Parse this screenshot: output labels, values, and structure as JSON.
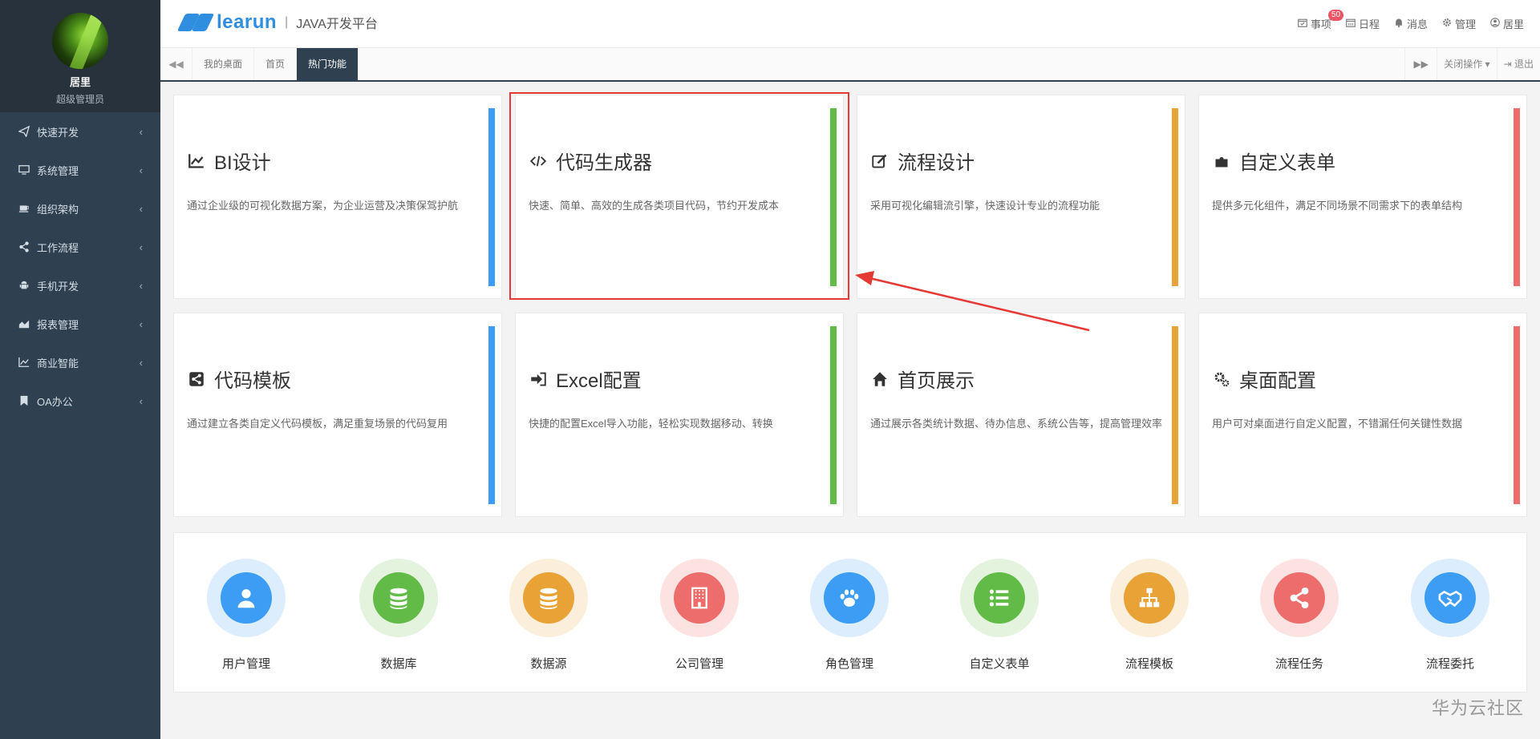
{
  "profile": {
    "name": "居里",
    "role": "超级管理员"
  },
  "sidebar": {
    "items": [
      {
        "label": "快速开发",
        "icon": "send-icon"
      },
      {
        "label": "系统管理",
        "icon": "desktop-icon"
      },
      {
        "label": "组织架构",
        "icon": "coffee-icon"
      },
      {
        "label": "工作流程",
        "icon": "share-icon"
      },
      {
        "label": "手机开发",
        "icon": "android-icon"
      },
      {
        "label": "报表管理",
        "icon": "area-chart-icon"
      },
      {
        "label": "商业智能",
        "icon": "line-chart-icon"
      },
      {
        "label": "OA办公",
        "icon": "bookmark-icon"
      }
    ],
    "arrow": "‹"
  },
  "header": {
    "brand": "learun",
    "separator": "|",
    "subtitle": "JAVA开发平台",
    "menu": [
      {
        "label": "事项",
        "icon": "calendar-check-icon",
        "badge": "50"
      },
      {
        "label": "日程",
        "icon": "calendar-icon"
      },
      {
        "label": "消息",
        "icon": "bell-icon"
      },
      {
        "label": "管理",
        "icon": "gear-icon"
      },
      {
        "label": "居里",
        "icon": "user-circle-icon"
      }
    ]
  },
  "tabs": {
    "items": [
      "我的桌面",
      "首页",
      "热门功能"
    ],
    "active_index": 2,
    "close_ops": "关闭操作",
    "logout": "退出"
  },
  "cards": [
    {
      "title": "BI设计",
      "icon": "line-chart-icon",
      "desc": "通过企业级的可视化数据方案，为企业运营及决策保驾护航",
      "color": "#3d9df4"
    },
    {
      "title": "代码生成器",
      "icon": "code-icon",
      "desc": "快速、简单、高效的生成各类项目代码，节约开发成本",
      "color": "#62bb46"
    },
    {
      "title": "流程设计",
      "icon": "edit-icon",
      "desc": "采用可视化编辑流引擎，快速设计专业的流程功能",
      "color": "#e8a236"
    },
    {
      "title": "自定义表单",
      "icon": "puzzle-icon",
      "desc": "提供多元化组件，满足不同场景不同需求下的表单结构",
      "color": "#ed6d6d"
    },
    {
      "title": "代码模板",
      "icon": "share-square-icon",
      "desc": "通过建立各类自定义代码模板，满足重复场景的代码复用",
      "color": "#3d9df4"
    },
    {
      "title": "Excel配置",
      "icon": "sign-in-icon",
      "desc": "快捷的配置Excel导入功能，轻松实现数据移动、转换",
      "color": "#62bb46"
    },
    {
      "title": "首页展示",
      "icon": "home-icon",
      "desc": "通过展示各类统计数据、待办信息、系统公告等，提高管理效率",
      "color": "#e8a236"
    },
    {
      "title": "桌面配置",
      "icon": "gears-icon",
      "desc": "用户可对桌面进行自定义配置，不错漏任何关键性数据",
      "color": "#ed6d6d"
    }
  ],
  "apps": [
    {
      "label": "用户管理",
      "icon": "user-icon",
      "color": "#3d9df4",
      "ring": "#dcedfd"
    },
    {
      "label": "数据库",
      "icon": "database-icon",
      "color": "#62bb46",
      "ring": "#e3f3de"
    },
    {
      "label": "数据源",
      "icon": "database-icon",
      "color": "#e8a236",
      "ring": "#fbeedb"
    },
    {
      "label": "公司管理",
      "icon": "building-icon",
      "color": "#ed6d6d",
      "ring": "#fde2e2"
    },
    {
      "label": "角色管理",
      "icon": "paw-icon",
      "color": "#3d9df4",
      "ring": "#dcedfd"
    },
    {
      "label": "自定义表单",
      "icon": "list-icon",
      "color": "#62bb46",
      "ring": "#e3f3de"
    },
    {
      "label": "流程模板",
      "icon": "sitemap-icon",
      "color": "#e8a236",
      "ring": "#fbeedb"
    },
    {
      "label": "流程任务",
      "icon": "share-alt-icon",
      "color": "#ed6d6d",
      "ring": "#fde2e2"
    },
    {
      "label": "流程委托",
      "icon": "handshake-icon",
      "color": "#3d9df4",
      "ring": "#dcedfd"
    }
  ],
  "watermark": "华为云社区",
  "colors": {
    "sidebar": "#2f4050",
    "accent": "#2f8ee0",
    "highlight": "#e53935"
  }
}
